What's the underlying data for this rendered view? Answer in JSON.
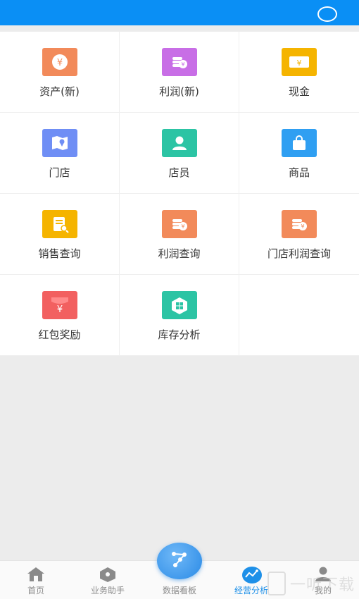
{
  "header": {
    "icon": "circle-icon"
  },
  "grid": {
    "items": [
      {
        "label": "资产(新)",
        "icon": "asset-yuan-icon",
        "color": "#f28a5a"
      },
      {
        "label": "利润(新)",
        "icon": "profit-coins-icon",
        "color": "#c86ee6"
      },
      {
        "label": "现金",
        "icon": "cash-note-icon",
        "color": "#f5b400"
      },
      {
        "label": "门店",
        "icon": "store-map-icon",
        "color": "#6f8ef5"
      },
      {
        "label": "店员",
        "icon": "clerk-person-icon",
        "color": "#2cc4a4"
      },
      {
        "label": "商品",
        "icon": "goods-bag-icon",
        "color": "#2f9ff2"
      },
      {
        "label": "销售查询",
        "icon": "sales-search-icon",
        "color": "#f5b400"
      },
      {
        "label": "利润查询",
        "icon": "profit-query-icon",
        "color": "#f28a5a"
      },
      {
        "label": "门店利润查询",
        "icon": "store-profit-icon",
        "color": "#f28a5a"
      },
      {
        "label": "红包奖励",
        "icon": "red-envelope-icon",
        "color": "#f26060"
      },
      {
        "label": "库存分析",
        "icon": "inventory-icon",
        "color": "#2cc4a4"
      }
    ]
  },
  "bottom_nav": {
    "tabs": [
      {
        "label": "首页",
        "icon": "home-icon"
      },
      {
        "label": "业务助手",
        "icon": "tag-icon"
      },
      {
        "label": "数据看板",
        "icon": "dashboard-icon"
      },
      {
        "label": "经营分析",
        "icon": "chart-icon",
        "active": true
      },
      {
        "label": "我的",
        "icon": "user-icon"
      }
    ]
  },
  "watermark": {
    "text": "一听下载"
  }
}
